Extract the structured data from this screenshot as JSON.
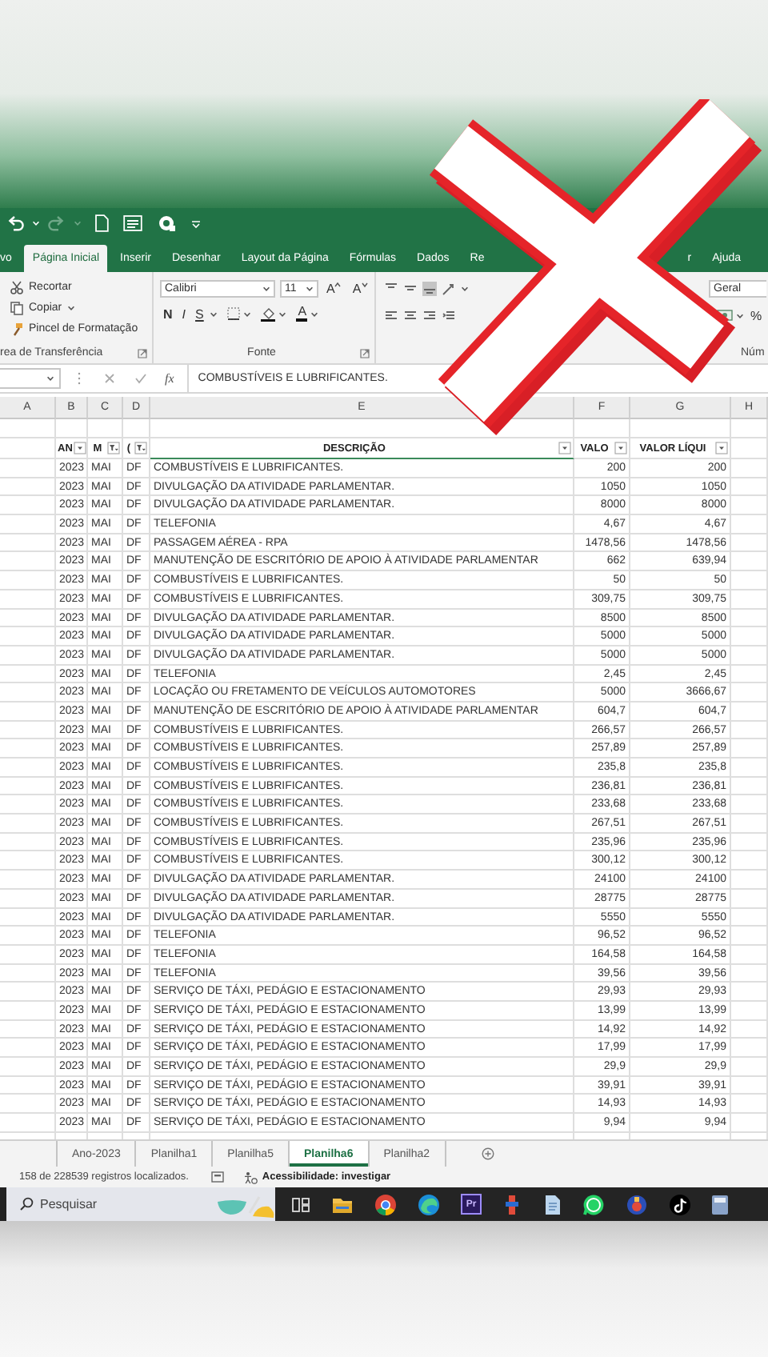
{
  "ribbon_tabs": [
    {
      "label": "vo",
      "selected": false
    },
    {
      "label": "Página Inicial",
      "selected": true
    },
    {
      "label": "Inserir",
      "selected": false
    },
    {
      "label": "Desenhar",
      "selected": false
    },
    {
      "label": "Layout da Página",
      "selected": false
    },
    {
      "label": "Fórmulas",
      "selected": false
    },
    {
      "label": "Dados",
      "selected": false
    },
    {
      "label": "Re",
      "selected": false
    },
    {
      "label": "r",
      "selected": false
    },
    {
      "label": "Ajuda",
      "selected": false
    }
  ],
  "clipboard": {
    "items": [
      {
        "label": "Recortar",
        "dropdown": false
      },
      {
        "label": "Copiar",
        "dropdown": true
      },
      {
        "label": "Pincel de Formatação",
        "dropdown": false
      }
    ],
    "group_label": "rea de Transferência"
  },
  "font": {
    "name": "Calibri",
    "size": "11",
    "size_buttons": [
      "A",
      "A"
    ],
    "style_buttons": [
      {
        "label": "N",
        "kind": "bold"
      },
      {
        "label": "I",
        "kind": "italic"
      },
      {
        "label": "S",
        "kind": "underline"
      }
    ],
    "color_button": "A",
    "group_label": "Fonte"
  },
  "alignment": {
    "vertical": [
      {
        "selected": false
      },
      {
        "selected": false
      },
      {
        "selected": true
      }
    ]
  },
  "number": {
    "format": "Geral",
    "percent": "%",
    "group_label": "Núm"
  },
  "formula_bar": {
    "function_label": "fx",
    "formula": "COMBUSTÍVEIS E LUBRIFICANTES."
  },
  "grid": {
    "column_letters": [
      "A",
      "B",
      "C",
      "D",
      "E",
      "F",
      "G",
      "H"
    ],
    "table": {
      "columns": [
        {
          "label": "AN",
          "filtered": false
        },
        {
          "label": "M",
          "filtered": true
        },
        {
          "label": "(",
          "filtered": true
        },
        {
          "label": "DESCRIÇÃO",
          "filtered": false
        },
        {
          "label": "VALO",
          "filtered": false
        },
        {
          "label": "VALOR LÍQUI",
          "filtered": false
        }
      ],
      "rows": [
        [
          "2023",
          "MAI",
          "DF",
          "COMBUSTÍVEIS E LUBRIFICANTES.",
          "200",
          "200"
        ],
        [
          "2023",
          "MAI",
          "DF",
          "DIVULGAÇÃO DA ATIVIDADE PARLAMENTAR.",
          "1050",
          "1050"
        ],
        [
          "2023",
          "MAI",
          "DF",
          "DIVULGAÇÃO DA ATIVIDADE PARLAMENTAR.",
          "8000",
          "8000"
        ],
        [
          "2023",
          "MAI",
          "DF",
          "TELEFONIA",
          "4,67",
          "4,67"
        ],
        [
          "2023",
          "MAI",
          "DF",
          "PASSAGEM AÉREA - RPA",
          "1478,56",
          "1478,56"
        ],
        [
          "2023",
          "MAI",
          "DF",
          "MANUTENÇÃO DE ESCRITÓRIO DE APOIO À ATIVIDADE PARLAMENTAR",
          "662",
          "639,94"
        ],
        [
          "2023",
          "MAI",
          "DF",
          "COMBUSTÍVEIS E LUBRIFICANTES.",
          "50",
          "50"
        ],
        [
          "2023",
          "MAI",
          "DF",
          "COMBUSTÍVEIS E LUBRIFICANTES.",
          "309,75",
          "309,75"
        ],
        [
          "2023",
          "MAI",
          "DF",
          "DIVULGAÇÃO DA ATIVIDADE PARLAMENTAR.",
          "8500",
          "8500"
        ],
        [
          "2023",
          "MAI",
          "DF",
          "DIVULGAÇÃO DA ATIVIDADE PARLAMENTAR.",
          "5000",
          "5000"
        ],
        [
          "2023",
          "MAI",
          "DF",
          "DIVULGAÇÃO DA ATIVIDADE PARLAMENTAR.",
          "5000",
          "5000"
        ],
        [
          "2023",
          "MAI",
          "DF",
          "TELEFONIA",
          "2,45",
          "2,45"
        ],
        [
          "2023",
          "MAI",
          "DF",
          "LOCAÇÃO OU FRETAMENTO DE VEÍCULOS AUTOMOTORES",
          "5000",
          "3666,67"
        ],
        [
          "2023",
          "MAI",
          "DF",
          "MANUTENÇÃO DE ESCRITÓRIO DE APOIO À ATIVIDADE PARLAMENTAR",
          "604,7",
          "604,7"
        ],
        [
          "2023",
          "MAI",
          "DF",
          "COMBUSTÍVEIS E LUBRIFICANTES.",
          "266,57",
          "266,57"
        ],
        [
          "2023",
          "MAI",
          "DF",
          "COMBUSTÍVEIS E LUBRIFICANTES.",
          "257,89",
          "257,89"
        ],
        [
          "2023",
          "MAI",
          "DF",
          "COMBUSTÍVEIS E LUBRIFICANTES.",
          "235,8",
          "235,8"
        ],
        [
          "2023",
          "MAI",
          "DF",
          "COMBUSTÍVEIS E LUBRIFICANTES.",
          "236,81",
          "236,81"
        ],
        [
          "2023",
          "MAI",
          "DF",
          "COMBUSTÍVEIS E LUBRIFICANTES.",
          "233,68",
          "233,68"
        ],
        [
          "2023",
          "MAI",
          "DF",
          "COMBUSTÍVEIS E LUBRIFICANTES.",
          "267,51",
          "267,51"
        ],
        [
          "2023",
          "MAI",
          "DF",
          "COMBUSTÍVEIS E LUBRIFICANTES.",
          "235,96",
          "235,96"
        ],
        [
          "2023",
          "MAI",
          "DF",
          "COMBUSTÍVEIS E LUBRIFICANTES.",
          "300,12",
          "300,12"
        ],
        [
          "2023",
          "MAI",
          "DF",
          "DIVULGAÇÃO DA ATIVIDADE PARLAMENTAR.",
          "24100",
          "24100"
        ],
        [
          "2023",
          "MAI",
          "DF",
          "DIVULGAÇÃO DA ATIVIDADE PARLAMENTAR.",
          "28775",
          "28775"
        ],
        [
          "2023",
          "MAI",
          "DF",
          "DIVULGAÇÃO DA ATIVIDADE PARLAMENTAR.",
          "5550",
          "5550"
        ],
        [
          "2023",
          "MAI",
          "DF",
          "TELEFONIA",
          "96,52",
          "96,52"
        ],
        [
          "2023",
          "MAI",
          "DF",
          "TELEFONIA",
          "164,58",
          "164,58"
        ],
        [
          "2023",
          "MAI",
          "DF",
          "TELEFONIA",
          "39,56",
          "39,56"
        ],
        [
          "2023",
          "MAI",
          "DF",
          "SERVIÇO DE TÁXI, PEDÁGIO E ESTACIONAMENTO",
          "29,93",
          "29,93"
        ],
        [
          "2023",
          "MAI",
          "DF",
          "SERVIÇO DE TÁXI, PEDÁGIO E ESTACIONAMENTO",
          "13,99",
          "13,99"
        ],
        [
          "2023",
          "MAI",
          "DF",
          "SERVIÇO DE TÁXI, PEDÁGIO E ESTACIONAMENTO",
          "14,92",
          "14,92"
        ],
        [
          "2023",
          "MAI",
          "DF",
          "SERVIÇO DE TÁXI, PEDÁGIO E ESTACIONAMENTO",
          "17,99",
          "17,99"
        ],
        [
          "2023",
          "MAI",
          "DF",
          "SERVIÇO DE TÁXI, PEDÁGIO E ESTACIONAMENTO",
          "29,9",
          "29,9"
        ],
        [
          "2023",
          "MAI",
          "DF",
          "SERVIÇO DE TÁXI, PEDÁGIO E ESTACIONAMENTO",
          "39,91",
          "39,91"
        ],
        [
          "2023",
          "MAI",
          "DF",
          "SERVIÇO DE TÁXI, PEDÁGIO E ESTACIONAMENTO",
          "14,93",
          "14,93"
        ],
        [
          "2023",
          "MAI",
          "DF",
          "SERVIÇO DE TÁXI, PEDÁGIO E ESTACIONAMENTO",
          "9,94",
          "9,94"
        ]
      ]
    }
  },
  "sheet_tabs": [
    {
      "label": "Ano-2023",
      "selected": false
    },
    {
      "label": "Planilha1",
      "selected": false
    },
    {
      "label": "Planilha5",
      "selected": false
    },
    {
      "label": "Planilha6",
      "selected": true
    },
    {
      "label": "Planilha2",
      "selected": false
    }
  ],
  "status_bar": {
    "records": "158 de 228539 registros localizados.",
    "accessibility": "Acessibilidade: investigar"
  },
  "taskbar": {
    "search": {
      "placeholder": "Pesquisar"
    },
    "video_app_label": "Pr"
  }
}
